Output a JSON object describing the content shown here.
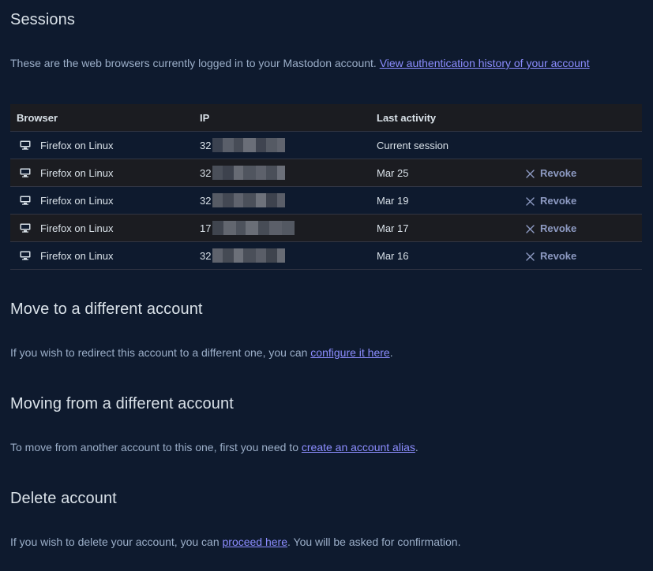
{
  "sessions": {
    "title": "Sessions",
    "description": "These are the web browsers currently logged in to your Mastodon account. ",
    "history_link": "View authentication history of your account",
    "columns": {
      "browser": "Browser",
      "ip": "IP",
      "last_activity": "Last activity"
    },
    "revoke_label": "Revoke",
    "rows": [
      {
        "browser": "Firefox on Linux",
        "ip_prefix": "32",
        "last_activity": "Current session",
        "revocable": false
      },
      {
        "browser": "Firefox on Linux",
        "ip_prefix": "32",
        "last_activity": "Mar 25",
        "revocable": true
      },
      {
        "browser": "Firefox on Linux",
        "ip_prefix": "32",
        "last_activity": "Mar 19",
        "revocable": true
      },
      {
        "browser": "Firefox on Linux",
        "ip_prefix": "17",
        "last_activity": "Mar 17",
        "revocable": true
      },
      {
        "browser": "Firefox on Linux",
        "ip_prefix": "32",
        "last_activity": "Mar 16",
        "revocable": true
      }
    ]
  },
  "move_account": {
    "title": "Move to a different account",
    "text_before": "If you wish to redirect this account to a different one, you can ",
    "link": "configure it here",
    "text_after": "."
  },
  "moving_from": {
    "title": "Moving from a different account",
    "text_before": "To move from another account to this one, first you need to ",
    "link": "create an account alias",
    "text_after": "."
  },
  "delete_account": {
    "title": "Delete account",
    "text_before": "If you wish to delete your account, you can ",
    "link": "proceed here",
    "text_after": ". You will be asked for confirmation."
  },
  "colors": {
    "background": "#0e1a2e",
    "row_alt": "#1b1c21",
    "link": "#8c8dff",
    "muted_text": "#9baec8"
  }
}
